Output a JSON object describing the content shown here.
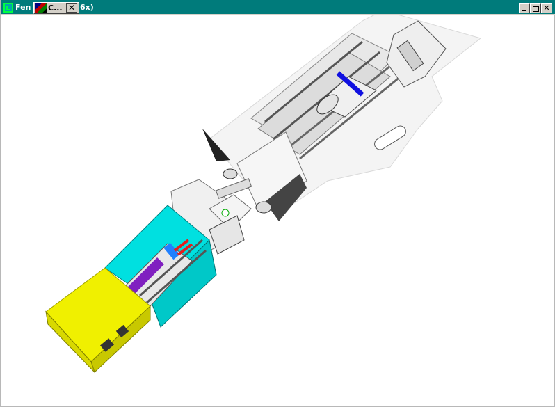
{
  "window": {
    "title_fragment_left": "Fen",
    "title_fragment_right": "6x)",
    "icon": "app-window-icon"
  },
  "overlay_task": {
    "label": "C...",
    "icon": "cad-app-icon",
    "close_glyph": "✕"
  },
  "controls": {
    "minimize": "minimize-icon",
    "maximize": "maximize-icon",
    "close": "close-icon",
    "close_glyph": "✕"
  },
  "viewport": {
    "content": "3D CAD render of cylinder/actuator assembly",
    "colors": {
      "background": "#ffffff",
      "body": "#f0f0f0",
      "shadow": "#404040",
      "cyan_housing": "#00e0e0",
      "yellow_cap": "#f0f000",
      "blue_band": "#1010e0",
      "purple_piston": "#8020c0",
      "red_seal": "#e02020"
    }
  }
}
